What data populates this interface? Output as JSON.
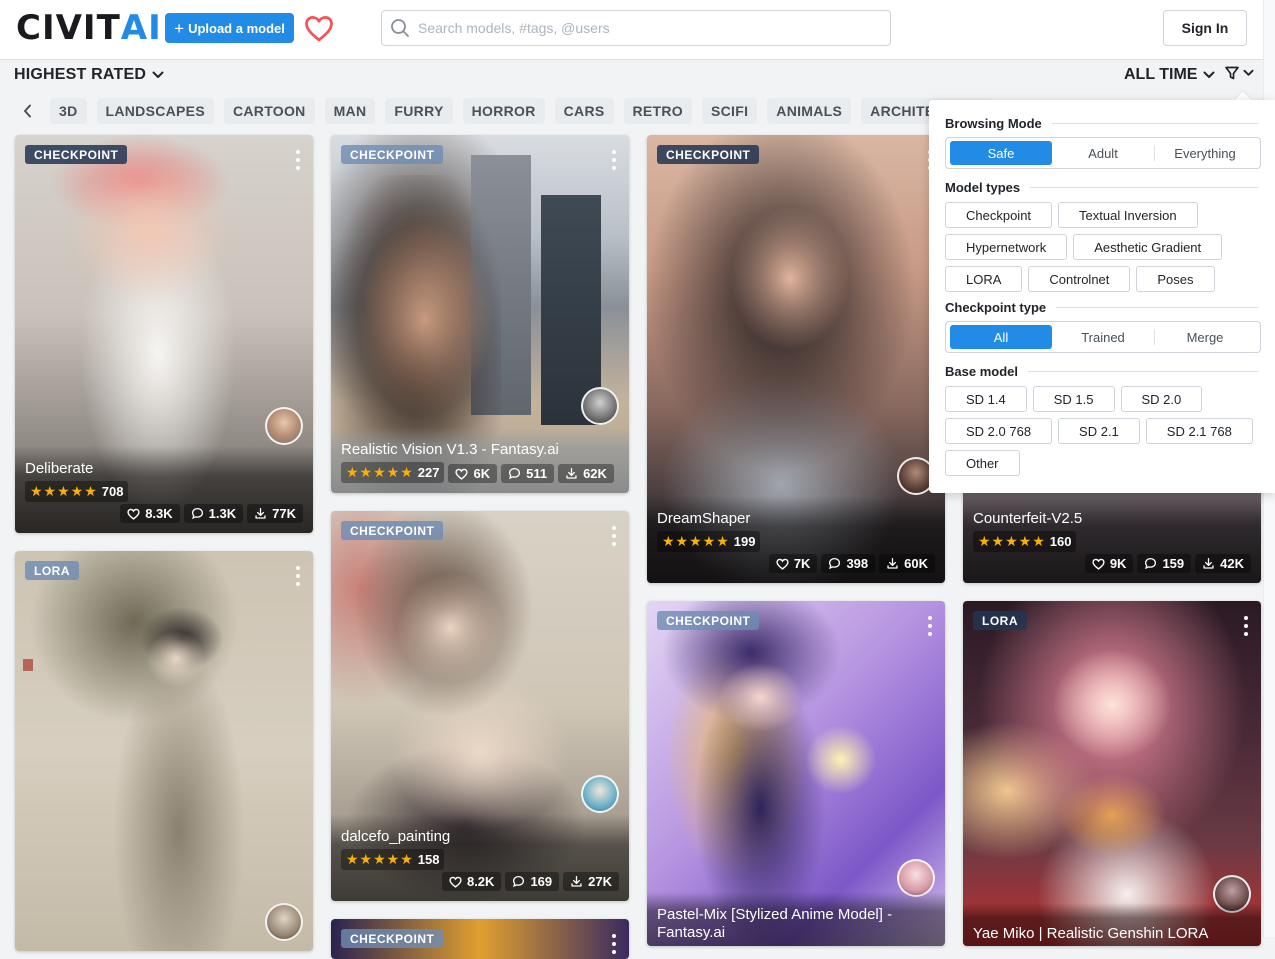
{
  "header": {
    "logo_left": "CIVIT",
    "logo_right": "AI",
    "upload_label": "Upload a model",
    "search_placeholder": "Search models, #tags, @users",
    "signin_label": "Sign In"
  },
  "toolbar": {
    "sort_label": "HIGHEST RATED",
    "period_label": "ALL TIME"
  },
  "tags": [
    "3D",
    "LANDSCAPES",
    "CARTOON",
    "MAN",
    "FURRY",
    "HORROR",
    "CARS",
    "RETRO",
    "SCIFI",
    "ANIMALS",
    "ARCHITECTURE"
  ],
  "cards": {
    "deliberate": {
      "badge": "CHECKPOINT",
      "title": "Deliberate",
      "rating_count": "708",
      "likes": "8.3K",
      "comments": "1.3K",
      "downloads": "77K",
      "stars": 5
    },
    "realistic": {
      "badge": "CHECKPOINT",
      "title": "Realistic Vision V1.3 - Fantasy.ai",
      "rating_count": "227",
      "likes": "6K",
      "comments": "511",
      "downloads": "62K",
      "stars": 5
    },
    "dreamshaper": {
      "badge": "CHECKPOINT",
      "title": "DreamShaper",
      "rating_count": "199",
      "likes": "7K",
      "comments": "398",
      "downloads": "60K",
      "stars": 5
    },
    "counterfeit": {
      "title": "Counterfeit-V2.5",
      "rating_count": "160",
      "likes": "9K",
      "comments": "159",
      "downloads": "42K",
      "stars": 5
    },
    "lora1": {
      "badge": "LORA"
    },
    "dalcefo": {
      "badge": "CHECKPOINT",
      "title": "dalcefo_painting",
      "rating_count": "158",
      "likes": "8.2K",
      "comments": "169",
      "downloads": "27K",
      "stars": 5
    },
    "pastel": {
      "badge": "CHECKPOINT",
      "title": "Pastel-Mix [Stylized Anime Model] - Fantasy.ai"
    },
    "yae": {
      "badge": "LORA",
      "title": "Yae Miko | Realistic Genshin LORA"
    },
    "bottom": {
      "badge": "CHECKPOINT"
    }
  },
  "filters": {
    "browsing_mode": {
      "heading": "Browsing Mode",
      "options": [
        "Safe",
        "Adult",
        "Everything"
      ],
      "selected": "Safe"
    },
    "model_types": {
      "heading": "Model types",
      "options": [
        "Checkpoint",
        "Textual Inversion",
        "Hypernetwork",
        "Aesthetic Gradient",
        "LORA",
        "Controlnet",
        "Poses"
      ]
    },
    "checkpoint_type": {
      "heading": "Checkpoint type",
      "options": [
        "All",
        "Trained",
        "Merge"
      ],
      "selected": "All"
    },
    "base_model": {
      "heading": "Base model",
      "options": [
        "SD 1.4",
        "SD 1.5",
        "SD 2.0",
        "SD 2.0 768",
        "SD 2.1",
        "SD 2.1 768",
        "Other"
      ]
    }
  },
  "colors": {
    "accent": "#228be6",
    "star": "#fab005",
    "heart": "#fa5252"
  }
}
